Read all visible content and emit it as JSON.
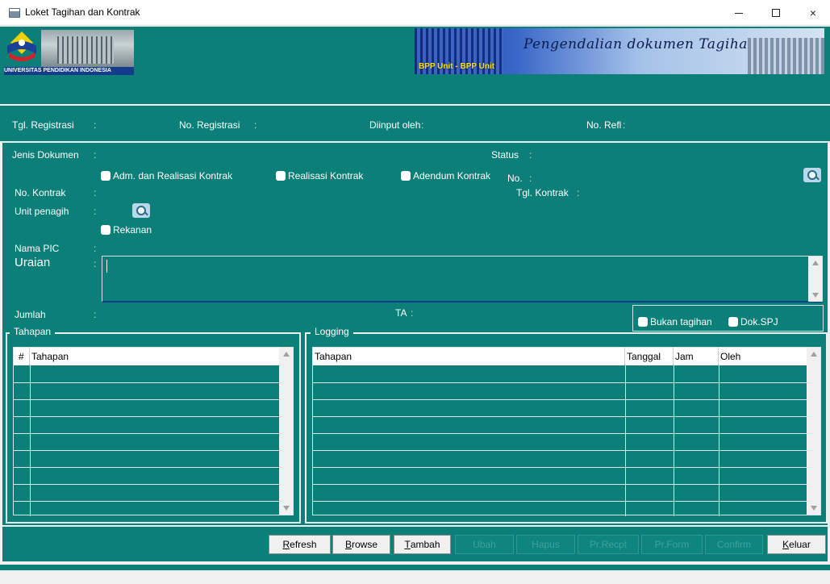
{
  "window": {
    "title": "Loket Tagihan dan Kontrak",
    "controls": {
      "minimize": "–",
      "maximize": "□",
      "close": "×"
    }
  },
  "header": {
    "logo_caption": "UNIVERSITAS PENDIDIKAN INDONESIA",
    "unit_label": "BPP Unit - BPP Unit",
    "doc_title": "Pengendalian dokumen Tagihan"
  },
  "registration": {
    "tgl_registrasi": "Tgl. Registrasi",
    "no_registrasi": "No. Registrasi",
    "diinput_oleh": "Diinput oleh",
    "no_refl": "No. Refl",
    "colon": ":"
  },
  "form": {
    "jenis_dokumen": "Jenis Dokumen",
    "status": "Status",
    "no": "No.",
    "no_kontrak": "No. Kontrak",
    "tgl_kontrak": "Tgl. Kontrak",
    "unit_penagih": "Unit penagih",
    "nama_pic": "Nama PIC",
    "uraian": "Uraian",
    "jumlah": "Jumlah",
    "ta": "TA",
    "colon": ":",
    "checkboxes": {
      "adm_realisasi": "Adm. dan Realisasi Kontrak",
      "realisasi": "Realisasi Kontrak",
      "adendum": "Adendum Kontrak",
      "rekanan": "Rekanan",
      "bukan_tagihan": "Bukan tagihan",
      "dok_spj": "Dok.SPJ"
    }
  },
  "tahapan_panel": {
    "title": "Tahapan",
    "columns": [
      "#",
      "Tahapan"
    ]
  },
  "logging_panel": {
    "title": "Logging",
    "columns": [
      "Tahapan",
      "Tanggal",
      "Jam",
      "Oleh"
    ]
  },
  "buttons": {
    "refresh": {
      "first": "R",
      "rest": "efresh"
    },
    "browse": {
      "first": "B",
      "rest": "rowse"
    },
    "tambah": {
      "first": "T",
      "rest": "ambah"
    },
    "ubah": "Ubah",
    "hapus": "Hapus",
    "pr_recpt": "Pr.Recpt",
    "pr_form": "Pr.Form",
    "confirm": "Confirm",
    "keluar": {
      "first": "K",
      "rest": "eluar"
    }
  },
  "colors": {
    "teal": "#0c7f78",
    "banner_blue": "#1d3d9a",
    "label_yellow": "#ffe100"
  }
}
